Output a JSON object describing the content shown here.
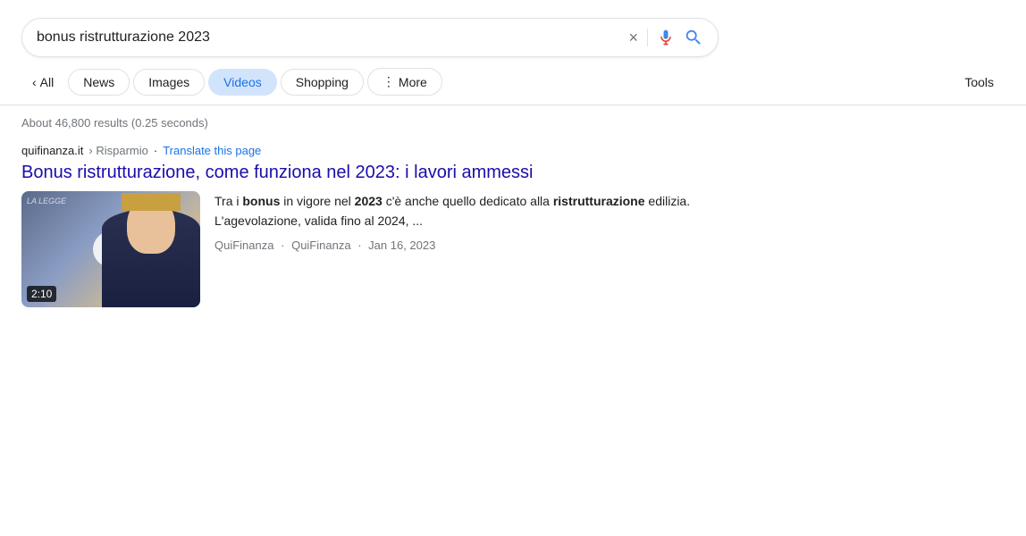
{
  "searchBar": {
    "query": "bonus ristrutturazione 2023",
    "clearLabel": "×",
    "voiceLabel": "voice search",
    "searchLabel": "search"
  },
  "filterTabs": {
    "backLabel": "‹",
    "allLabel": "All",
    "tabs": [
      {
        "id": "news",
        "label": "News",
        "active": false
      },
      {
        "id": "images",
        "label": "Images",
        "active": false
      },
      {
        "id": "videos",
        "label": "Videos",
        "active": true
      },
      {
        "id": "shopping",
        "label": "Shopping",
        "active": false
      }
    ],
    "moreLabel": "More",
    "moreIcon": "⋮",
    "toolsLabel": "Tools"
  },
  "resultsCount": "About 46,800 results (0.25 seconds)",
  "result": {
    "domain": "quifinanza.it",
    "breadcrumb": "› Risparmio",
    "translateText": "Translate this page",
    "title": "Bonus ristrutturazione, come funziona nel 2023: i lavori ammessi",
    "snippetParts": [
      {
        "text": "Tra i ",
        "bold": false
      },
      {
        "text": "bonus",
        "bold": true
      },
      {
        "text": " in vigore nel ",
        "bold": false
      },
      {
        "text": "2023",
        "bold": true
      },
      {
        "text": " c'è anche quello dedicato alla ",
        "bold": false
      },
      {
        "text": "ristrutturazione",
        "bold": true
      },
      {
        "text": " edilizia. L'agevolazione, valida fino al 2024, ...",
        "bold": false
      }
    ],
    "video": {
      "duration": "2:10",
      "watermark": "LA LEGGE"
    },
    "metaParts": [
      {
        "text": "QuiFinanza",
        "sep": ""
      },
      {
        "text": "QuiFinanza",
        "sep": " · "
      },
      {
        "text": "Jan 16, 2023",
        "sep": " · "
      }
    ]
  }
}
